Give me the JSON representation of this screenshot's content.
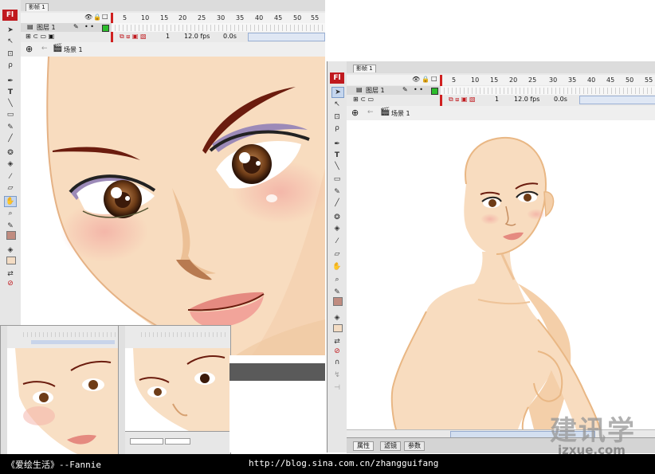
{
  "left_window": {
    "tab_label": "影帧 1",
    "layer_name": "图层 1",
    "frame_numbers": [
      "5",
      "10",
      "15",
      "20",
      "25",
      "30",
      "35",
      "40",
      "45",
      "50",
      "55"
    ],
    "frame_value": "1",
    "fps": "12.0 fps",
    "time": "0.0s",
    "scene_label": "场景 1"
  },
  "right_window": {
    "tab_label": "影帧 1",
    "layer_name": "图层 1",
    "frame_numbers": [
      "5",
      "10",
      "15",
      "20",
      "25",
      "30",
      "35",
      "40",
      "45",
      "50",
      "55"
    ],
    "frame_value": "1",
    "fps": "12.0 fps",
    "time": "0.0s",
    "scene_label": "场景 1",
    "bottom_tabs": [
      "属性",
      "滤镜",
      "参数"
    ]
  },
  "app_logo": "Fl",
  "tool_icons": [
    "arrow",
    "subselect",
    "free-transform",
    "lasso",
    "pen",
    "text",
    "line",
    "rect",
    "pencil",
    "brush",
    "ink-bottle",
    "paint-bucket",
    "eyedropper",
    "eraser",
    "hand",
    "zoom",
    "stroke-color",
    "fill-color",
    "swap",
    "default-colors"
  ],
  "caption": {
    "left": "《爱绘生活》--Fannie",
    "url": "http://blog.sina.com.cn/zhangguifang"
  },
  "watermark": {
    "cn": "建讯学",
    "url": "jzxue.com"
  },
  "colors": {
    "skin": "#f8dbbd",
    "skin_shadow": "#e9b784",
    "brow": "#6b1c0e",
    "lip": "#e58a80",
    "eye_shadow": "#9c8ab8",
    "flash_red": "#c0191e"
  }
}
